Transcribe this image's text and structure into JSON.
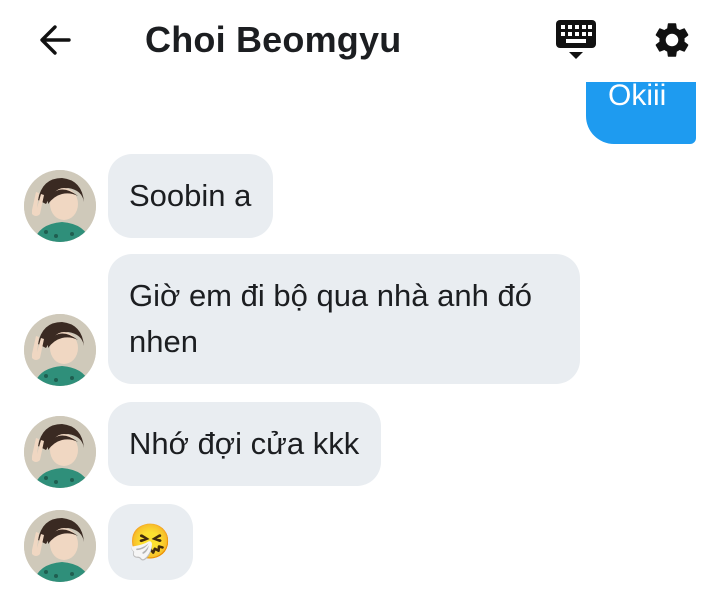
{
  "header": {
    "title": "Choi Beomgyu",
    "back_icon": "arrow-left-icon",
    "keyboard_icon": "keyboard-icon",
    "settings_icon": "gear-icon"
  },
  "colors": {
    "outgoing_bubble": "#1e9bf0",
    "incoming_bubble": "#e9edf1",
    "text": "#1c1e21"
  },
  "messages": {
    "outgoing_partial": "Okiii",
    "incoming": [
      {
        "text": "Soobin a"
      },
      {
        "text": "Giờ em đi bộ qua nhà anh đó nhen"
      },
      {
        "text": "Nhớ đợi cửa kkk"
      },
      {
        "text": "🤧"
      }
    ]
  }
}
